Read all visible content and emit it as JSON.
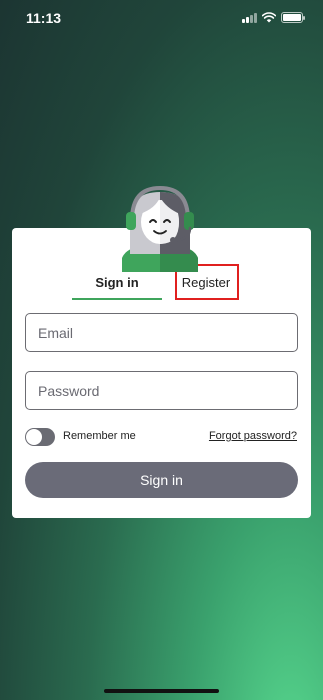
{
  "status_bar": {
    "time": "11:13",
    "icons": [
      "signal-icon",
      "wifi-icon",
      "battery-icon"
    ]
  },
  "avatar": {
    "icon": "support-agent-avatar-icon",
    "colors": {
      "headset": "#3fa55c",
      "hair": "#5d5d66",
      "shirt": "#3fa55c"
    }
  },
  "tabs": {
    "signin": "Sign in",
    "register": "Register",
    "active": "signin",
    "accent_color": "#3fa55c"
  },
  "form": {
    "email_placeholder": "Email",
    "password_placeholder": "Password",
    "remember_label": "Remember me",
    "remember_checked": false,
    "forgot_label": "Forgot password?",
    "submit_label": "Sign in",
    "submit_color": "#6a6b78"
  },
  "highlight_color": "#e0201f"
}
